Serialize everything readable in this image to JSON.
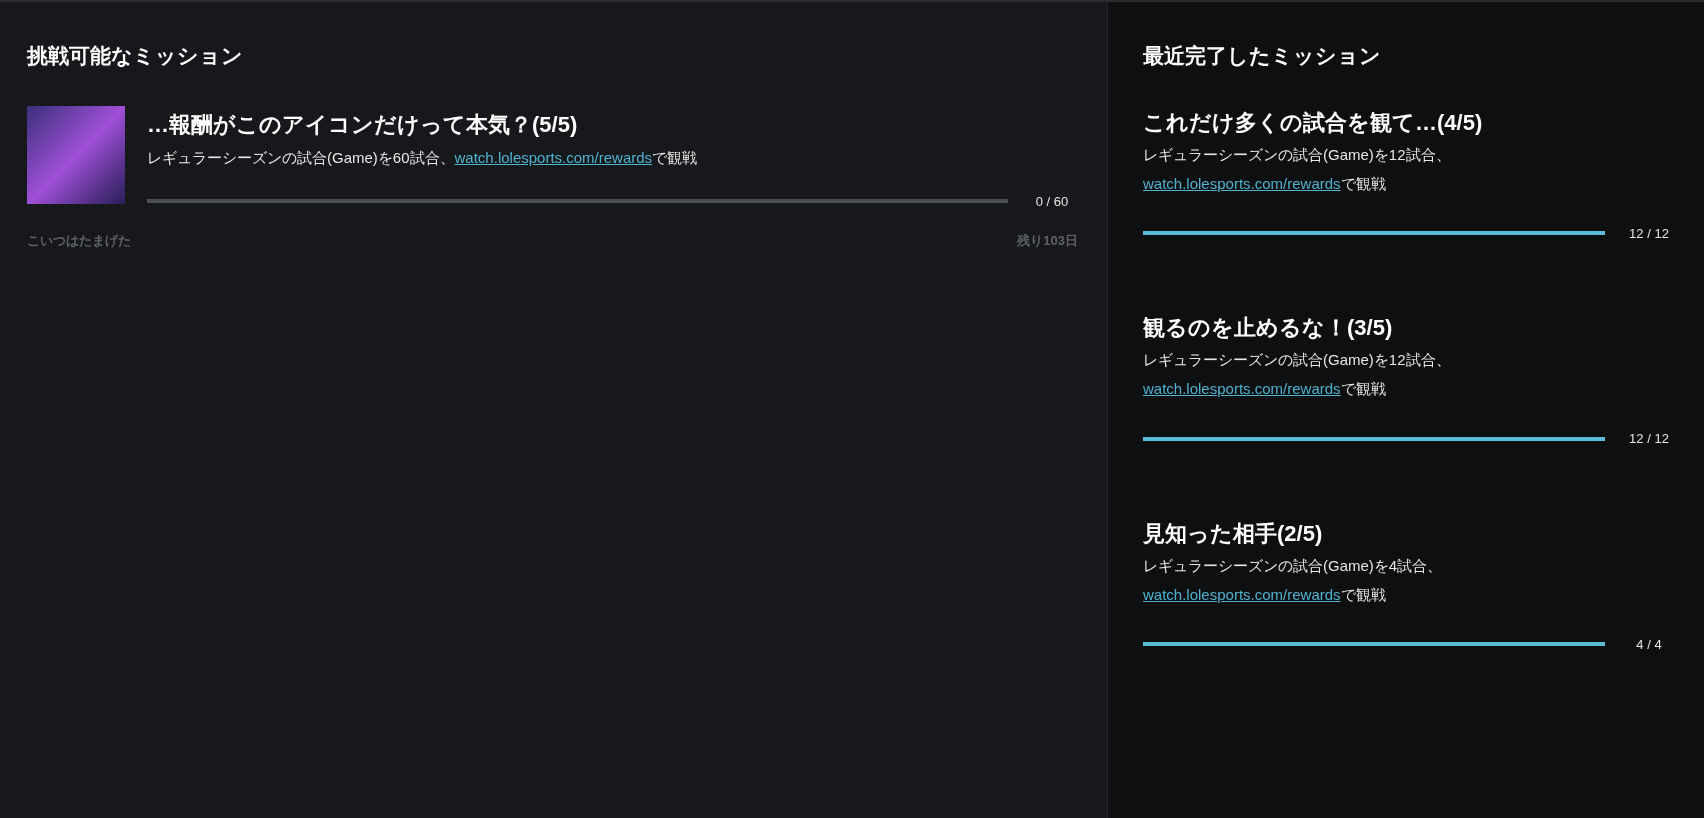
{
  "available": {
    "heading": "挑戦可能なミッション",
    "missions": [
      {
        "title": "…報酬がこのアイコンだけって本気？(5/5)",
        "text_before": "レギュラーシーズンの試合(Game)を60試合、",
        "link": "watch.lolesports.com/rewards",
        "text_after": "で観戦",
        "level": 0,
        "reading": "0 / 60",
        "reward": "こいつはたまげた",
        "remaining": "残り103日"
      }
    ]
  },
  "completed": {
    "heading": "最近完了したミッション",
    "missions": [
      {
        "title": "これだけ多くの試合を観て…(4/5)",
        "text_before": "レギュラーシーズンの試合(Game)を12試合、",
        "link": "watch.lolesports.com/rewards",
        "text_after": "で観戦",
        "level": 1,
        "reading": "12 / 12"
      },
      {
        "title": "観るのを止めるな！(3/5)",
        "text_before": "レギュラーシーズンの試合(Game)を12試合、",
        "link": "watch.lolesports.com/rewards",
        "text_after": "で観戦",
        "level": 1,
        "reading": "12 / 12"
      },
      {
        "title": "見知った相手(2/5)",
        "text_before": "レギュラーシーズンの試合(Game)を4試合、",
        "link": "watch.lolesports.com/rewards",
        "text_after": "で観戦",
        "level": 1,
        "reading": "4 / 4"
      }
    ]
  }
}
